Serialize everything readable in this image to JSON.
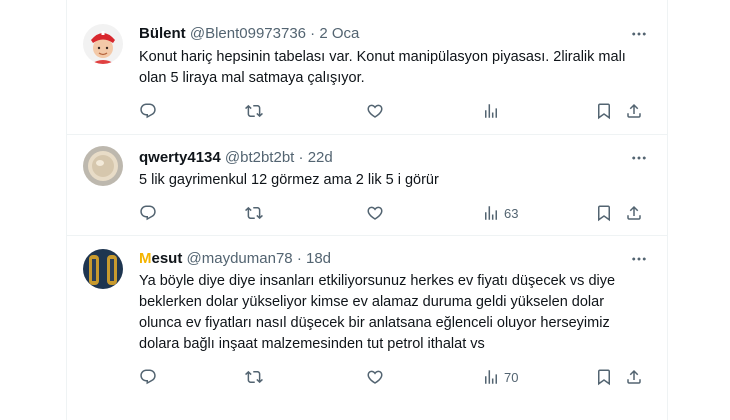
{
  "tweets": [
    {
      "name": "Bülent",
      "handle": "@Blent09973736",
      "separator": "·",
      "time": "2 Oca",
      "text": "Konut hariç hepsinin tabelası var. Konut manipülasyon piyasası. 2liralik malı olan 5 liraya mal satmaya çalışıyor.",
      "views": ""
    },
    {
      "name": "qwerty4134",
      "handle": "@bt2bt2bt",
      "separator": "·",
      "time": "22d",
      "text": "5 lik gayrimenkul 12 görmez ama 2 lik 5 i görür",
      "views": "63"
    },
    {
      "name": "esut",
      "name_logo": "M",
      "handle": "@mayduman78",
      "separator": "·",
      "time": "18d",
      "text": "Ya böyle diye diye insanları etkiliyorsunuz herkes ev fiyatı düşecek vs diye beklerken dolar yükseliyor kimse ev alamaz duruma geldi yükselen dolar olunca ev fiyatları nasıl düşecek bir anlatsana eğlenceli oluyor herseyimiz dolara bağlı inşaat malzemesinden tut petrol ithalat vs",
      "views": "70"
    }
  ],
  "colors": {
    "text": "#0f1419",
    "secondary": "#536471",
    "border": "#eff3f4",
    "logo_m": "#f4b400"
  },
  "icons": [
    "reply-icon",
    "retweet-icon",
    "like-icon",
    "views-icon",
    "bookmark-icon",
    "share-icon",
    "more-icon"
  ]
}
